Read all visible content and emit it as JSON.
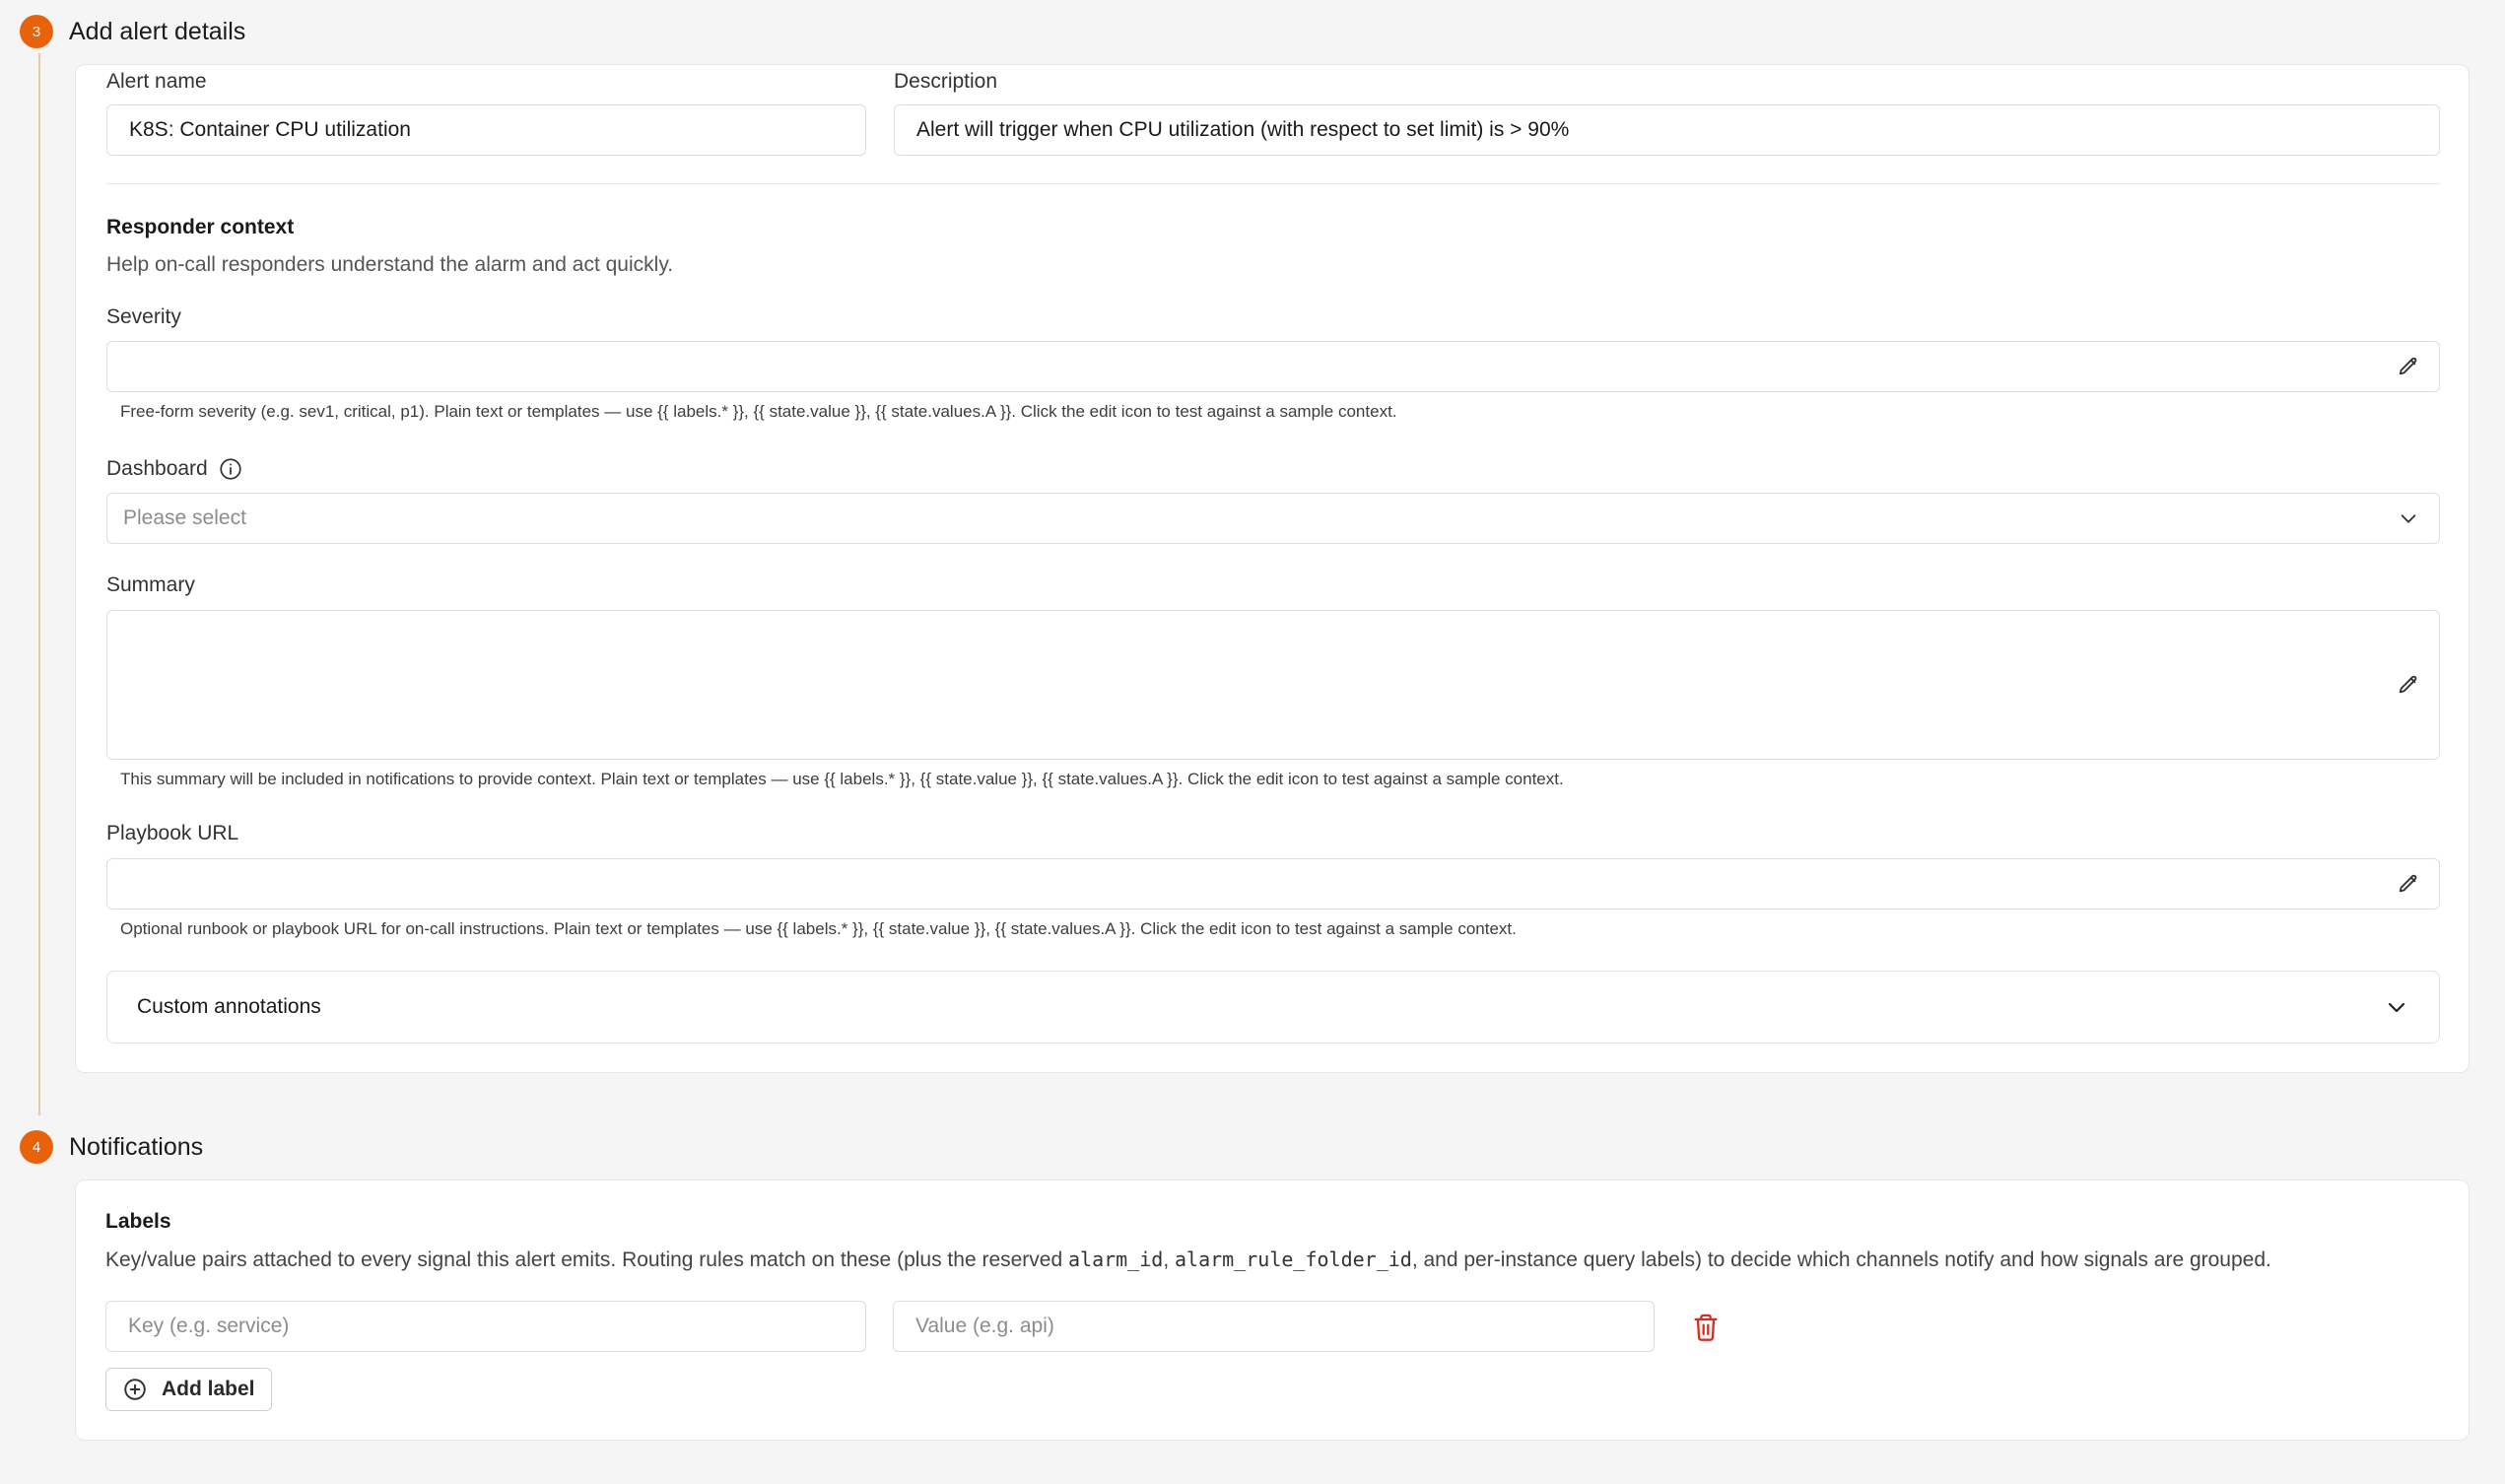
{
  "steps": {
    "alert_details": {
      "number": "3",
      "title": "Add alert details",
      "alert_name_label": "Alert name",
      "alert_name_value": "K8S: Container CPU utilization",
      "description_label": "Description",
      "description_value": "Alert will trigger when CPU utilization (with respect to set limit) is > 90%",
      "responder_context_title": "Responder context",
      "responder_context_subtitle": "Help on-call responders understand the alarm and act quickly.",
      "severity_label": "Severity",
      "severity_value": "",
      "severity_help": "Free-form severity (e.g. sev1, critical, p1). Plain text or templates — use {{ labels.* }}, {{ state.value }}, {{ state.values.A }}. Click the edit icon to test against a sample context.",
      "dashboard_label": "Dashboard",
      "dashboard_placeholder": "Please select",
      "summary_label": "Summary",
      "summary_value": "",
      "summary_help": "This summary will be included in notifications to provide context. Plain text or templates — use {{ labels.* }}, {{ state.value }}, {{ state.values.A }}. Click the edit icon to test against a sample context.",
      "playbook_label": "Playbook URL",
      "playbook_value": "",
      "playbook_help": "Optional runbook or playbook URL for on-call instructions. Plain text or templates — use {{ labels.* }}, {{ state.value }}, {{ state.values.A }}. Click the edit icon to test against a sample context.",
      "custom_annotations_label": "Custom annotations"
    },
    "notifications": {
      "number": "4",
      "title": "Notifications",
      "labels_title": "Labels",
      "labels_desc_part1": "Key/value pairs attached to every signal this alert emits. Routing rules match on these (plus the reserved ",
      "labels_desc_code1": "alarm_id",
      "labels_desc_sep": ", ",
      "labels_desc_code2": "alarm_rule_folder_id",
      "labels_desc_part2": ", and per-instance query labels) to decide which channels notify and how signals are grouped.",
      "key_placeholder": "Key (e.g. service)",
      "value_placeholder": "Value (e.g. api)",
      "add_label": "Add label"
    }
  },
  "colors": {
    "accent": "#e8620c",
    "delete": "#d92d20"
  },
  "icons": [
    "pencil-icon",
    "info-icon",
    "chevron-down-icon",
    "trash-icon",
    "plus-circle-icon"
  ]
}
